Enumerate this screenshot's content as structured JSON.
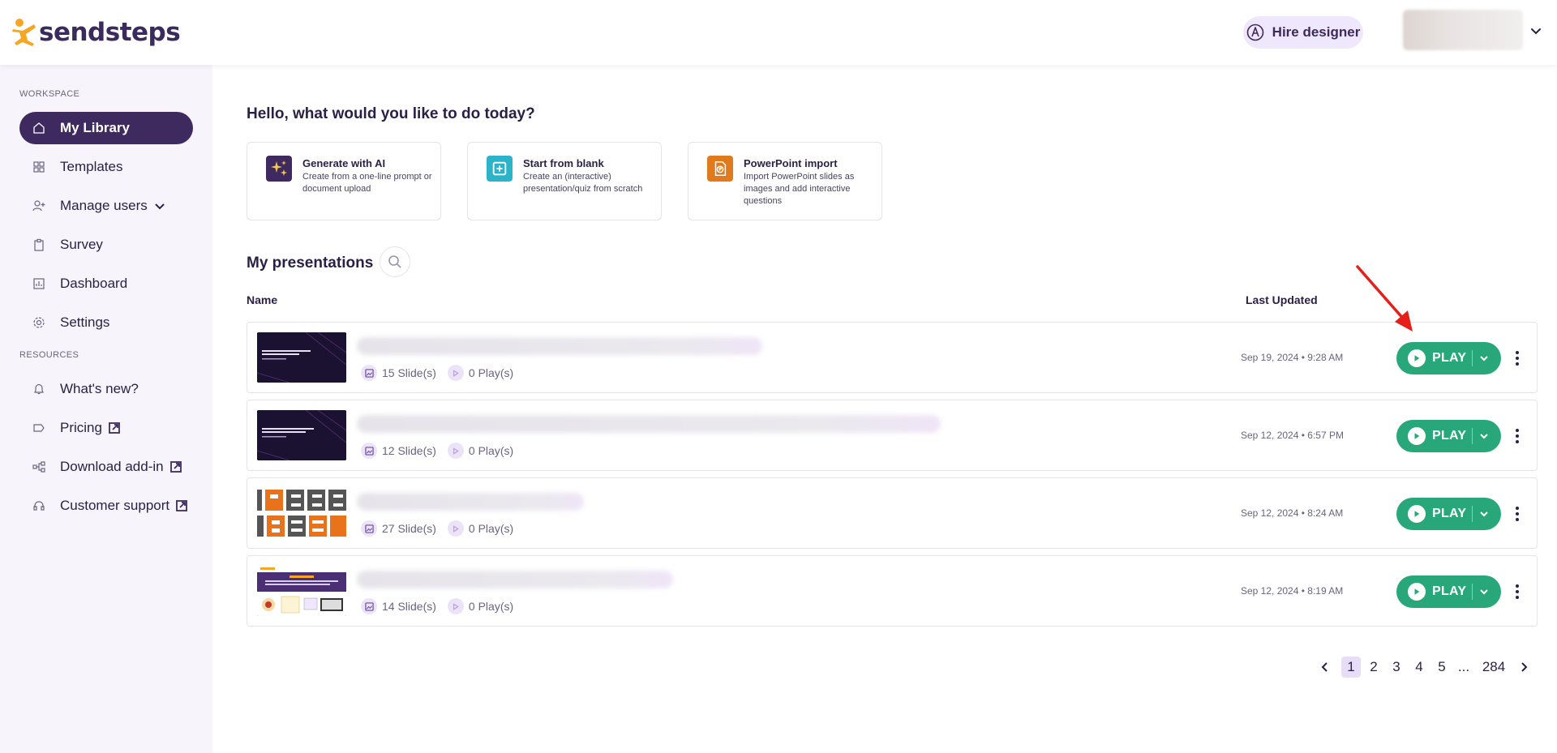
{
  "header": {
    "logo_text": "sendsteps",
    "hire_label": "Hire designer"
  },
  "sidebar": {
    "workspace_label": "WORKSPACE",
    "resources_label": "RESOURCES",
    "items": [
      {
        "label": "My Library",
        "icon": "home-icon"
      },
      {
        "label": "Templates",
        "icon": "grid-icon"
      },
      {
        "label": "Manage users",
        "icon": "user-plus-icon"
      },
      {
        "label": "Survey",
        "icon": "clipboard-icon"
      },
      {
        "label": "Dashboard",
        "icon": "chart-icon"
      },
      {
        "label": "Settings",
        "icon": "gear-icon"
      },
      {
        "label": "What's new?",
        "icon": "bell-icon"
      },
      {
        "label": "Pricing",
        "icon": "tag-icon"
      },
      {
        "label": "Download add-in",
        "icon": "addin-icon"
      },
      {
        "label": "Customer support",
        "icon": "headset-icon"
      }
    ]
  },
  "main": {
    "greeting": "Hello, what would you like to do today?",
    "actions": [
      {
        "title": "Generate with AI",
        "desc": "Create from a one-line prompt or document upload",
        "icon": "sparkles-icon",
        "color": "#3e2a5e"
      },
      {
        "title": "Start from blank",
        "desc": "Create an (interactive) presentation/quiz from scratch",
        "icon": "plus-square-icon",
        "color": "#2bb3c9"
      },
      {
        "title": "PowerPoint import",
        "desc": "Import PowerPoint slides as images and add interactive questions",
        "icon": "powerpoint-icon",
        "color": "#e07a1a"
      }
    ],
    "presentations_title": "My presentations",
    "col_name": "Name",
    "col_updated": "Last Updated",
    "play_label": "PLAY",
    "rows": [
      {
        "slides": "15 Slide(s)",
        "plays": "0 Play(s)",
        "updated": "Sep 19, 2024 • 9:28 AM",
        "thumb": "dark"
      },
      {
        "slides": "12 Slide(s)",
        "plays": "0 Play(s)",
        "updated": "Sep 12, 2024 • 6:57 PM",
        "thumb": "dark"
      },
      {
        "slides": "27 Slide(s)",
        "plays": "0 Play(s)",
        "updated": "Sep 12, 2024 • 8:24 AM",
        "thumb": "letters"
      },
      {
        "slides": "14 Slide(s)",
        "plays": "0 Play(s)",
        "updated": "Sep 12, 2024 • 8:19 AM",
        "thumb": "light"
      }
    ],
    "pagination": {
      "pages": [
        "1",
        "2",
        "3",
        "4",
        "5",
        "...",
        "284"
      ],
      "current": "1"
    }
  },
  "colors": {
    "brand_purple": "#3e2a5e",
    "play_green": "#28a87a",
    "accent_orange": "#f5a623",
    "annotation_red": "#e5201b"
  }
}
